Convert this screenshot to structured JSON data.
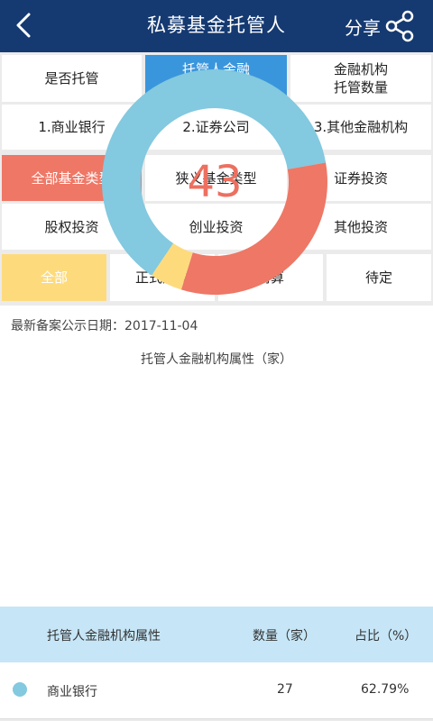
{
  "header": {
    "title": "私募基金托管人",
    "share_label": "分享"
  },
  "icons": {
    "back": "chevron-left-icon",
    "share": "share-icon"
  },
  "row1": [
    "是否托管",
    "托管人金融\n机构属性",
    "金融机构\n托管数量"
  ],
  "row2": [
    "1.商业银行",
    "2.证券公司",
    "3.其他金融机构"
  ],
  "row3": [
    "全部基金类型",
    "狭义基金类型",
    "证券投资"
  ],
  "row4": [
    "股权投资",
    "创业投资",
    "其他投资"
  ],
  "row5": [
    "全部",
    "正式运作",
    "清算",
    "待定"
  ],
  "selected": {
    "row1": "托管人金融\n机构属性",
    "row3": "全部基金类型",
    "row5": "全部"
  },
  "colors": {
    "header_bg": "#153a72",
    "blue": "#3a96dc",
    "red": "#ef7766",
    "yellow": "#fddb7d",
    "teal": "#83c9df"
  },
  "info": {
    "date_text": "最新备案公示日期：2017-11-04"
  },
  "chart_data": {
    "type": "pie",
    "title": "托管人金融机构属性（家）",
    "total_label": "43",
    "slices": [
      {
        "label": "商业银行",
        "value": 27,
        "color": "#83c9df"
      },
      {
        "label": "",
        "value": 14,
        "color": "#ee7766"
      },
      {
        "label": "",
        "value": 2,
        "color": "#fddb7d"
      }
    ]
  },
  "table": {
    "headers": [
      "托管人金融机构属性",
      "数量（家）",
      "占比（%）"
    ],
    "rows": [
      {
        "name": "商业银行",
        "count": "27",
        "percent": "62.79%"
      }
    ]
  }
}
